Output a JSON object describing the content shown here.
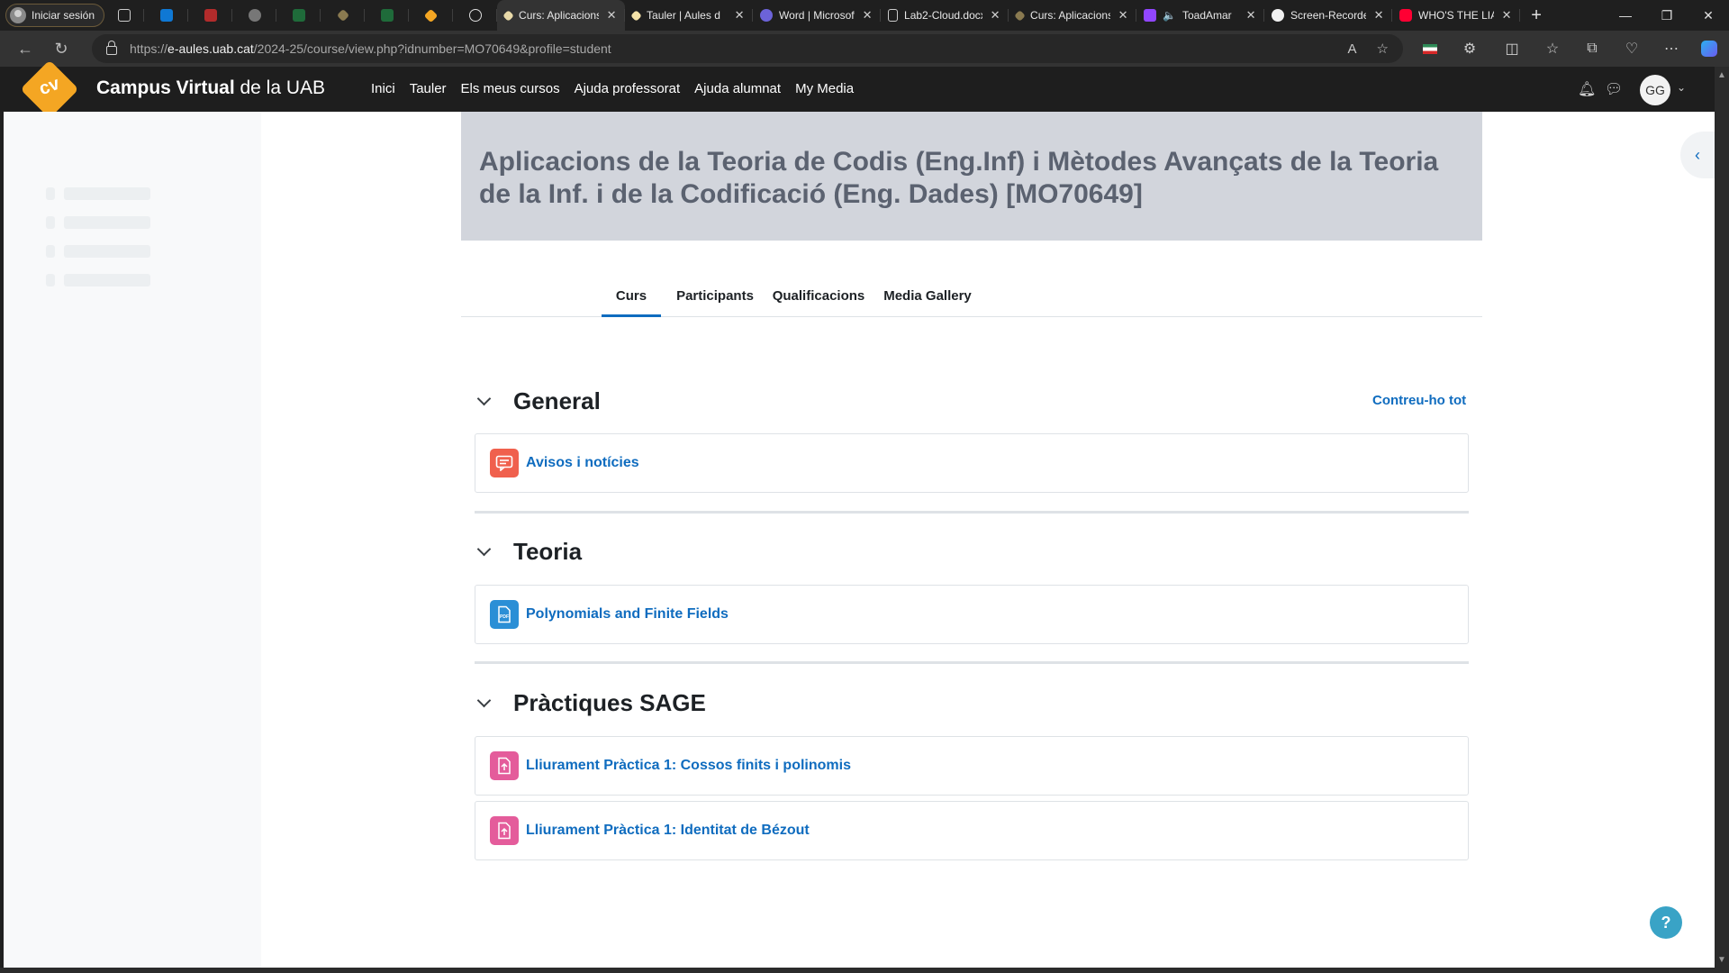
{
  "browser": {
    "profile_label": "Iniciar sesión",
    "tabs": [
      {
        "title": "Curs: Aplicacions",
        "active": true
      },
      {
        "title": "Tauler | Aules d",
        "active": false
      },
      {
        "title": "Word | Microsoft",
        "active": false
      },
      {
        "title": "Lab2-Cloud.docx",
        "active": false
      },
      {
        "title": "Curs: Aplicacions",
        "active": false
      },
      {
        "title": "ToadAmar",
        "active": false
      },
      {
        "title": "Screen-Recorder",
        "active": false
      },
      {
        "title": "WHO'S THE LIA",
        "active": false
      }
    ],
    "url_prefix": "https://",
    "url_host": "e-aules.uab.cat",
    "url_path": "/2024-25/course/view.php?idnumber=MO70649&profile=student"
  },
  "site": {
    "logo_text": "cv",
    "brand_bold": "Campus Virtual",
    "brand_rest": " de la UAB",
    "nav": [
      "Inici",
      "Tauler",
      "Els meus cursos",
      "Ajuda professorat",
      "Ajuda alumnat",
      "My Media"
    ],
    "user_initials": "GG"
  },
  "course": {
    "title": "Aplicacions de la Teoria de Codis (Eng.Inf) i Mètodes Avançats de la Teoria de la Inf. i de la Codificació (Eng. Dades) [MO70649]",
    "tabs": [
      "Curs",
      "Participants",
      "Qualificacions",
      "Media Gallery"
    ],
    "active_tab": "Curs",
    "collapse_all_label": "Contreu-ho tot",
    "sections": [
      {
        "title": "General",
        "activities": [
          {
            "name": "Avisos i notícies",
            "icon": "forum-icon"
          }
        ]
      },
      {
        "title": "Teoria",
        "activities": [
          {
            "name": "Polynomials and Finite Fields",
            "icon": "pdf-icon"
          }
        ]
      },
      {
        "title": "Pràctiques SAGE",
        "activities": [
          {
            "name": "Lliurament Pràctica 1: Cossos finits i polinomis",
            "icon": "assignment-icon"
          },
          {
            "name": "Lliurament Pràctica 1: Identitat de Bézout",
            "icon": "assignment-icon"
          }
        ]
      }
    ]
  },
  "help_label": "?",
  "colors": {
    "accent": "#0f6cbf",
    "brand": "#f4a623",
    "forum": "#f0604d",
    "pdf": "#2b8fd6",
    "assignment": "#e45c9b"
  }
}
